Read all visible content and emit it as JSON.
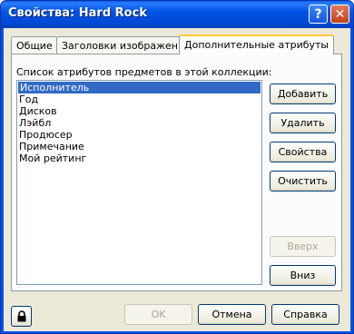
{
  "window": {
    "title": "Свойства: Hard Rock",
    "help_glyph": "?",
    "close_glyph": "✕"
  },
  "tabs": [
    {
      "label": "Общие",
      "active": false
    },
    {
      "label": "Заголовки изображений",
      "active": false
    },
    {
      "label": "Дополнительные атрибуты",
      "active": true
    }
  ],
  "attributes": {
    "list_label": "Список атрибутов предметов в этой коллекции:",
    "items": [
      "Исполнитель",
      "Год",
      "Дисков",
      "Лэйбл",
      "Продюсер",
      "Примечание",
      "Мой рейтинг"
    ],
    "selected_index": 0
  },
  "side_buttons": {
    "add": "Добавить",
    "delete": "Удалить",
    "properties": "Свойства",
    "clear": "Очистить",
    "up": "Вверх",
    "down": "Вниз"
  },
  "footer": {
    "ok": "OK",
    "cancel": "Отмена",
    "help": "Справка",
    "lock_icon": "lock-icon"
  },
  "colors": {
    "titlebar": "#0054e3",
    "selection": "#316ac5",
    "active_tab_accent": "#ffc83c"
  }
}
